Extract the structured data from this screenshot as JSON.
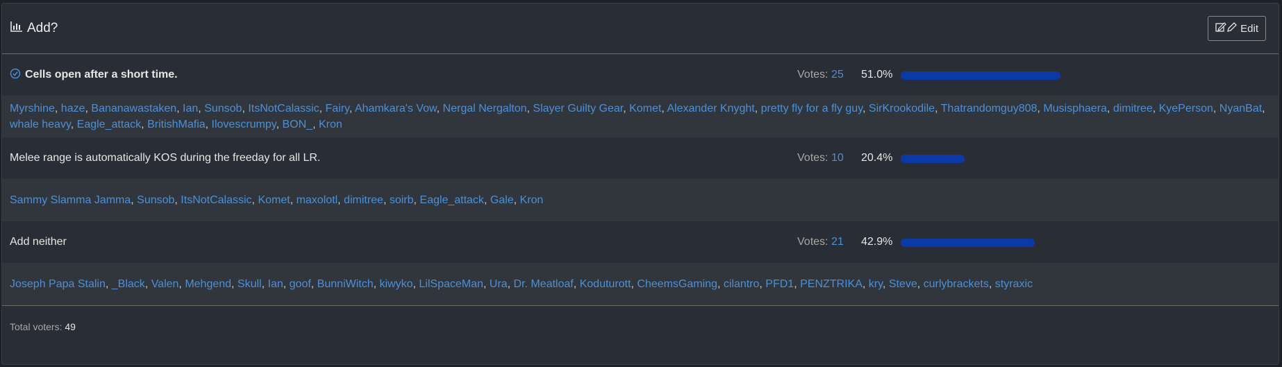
{
  "poll": {
    "title": "Add?",
    "edit_label": "Edit",
    "votes_prefix": "Votes:",
    "options": [
      {
        "label": "Cells open after a short time.",
        "votes": "25",
        "percent": "51.0%",
        "fraction": 0.51,
        "voters": [
          "Myrshine",
          "haze",
          "Bananawastaken",
          "Ian",
          "Sunsob",
          "ItsNotCalassic",
          "Fairy",
          "Ahamkara's Vow",
          "Nergal Nergalton",
          "Slayer Guilty Gear",
          "Komet",
          "Alexander Knyght",
          "pretty fly for a fly guy",
          "SirKrookodile",
          "Thatrandomguy808",
          "Musisphaera",
          "dimitree",
          "KyePerson",
          "NyanBat",
          "whale heavy",
          "Eagle_attack",
          "BritishMafia",
          "Ilovescrumpy",
          "BON_",
          "Kron"
        ]
      },
      {
        "label": "Melee range is automatically KOS during the freeday for all LR.",
        "votes": "10",
        "percent": "20.4%",
        "fraction": 0.204,
        "voters": [
          "Sammy Slamma Jamma",
          "Sunsob",
          "ItsNotCalassic",
          "Komet",
          "maxolotl",
          "dimitree",
          "soirb",
          "Eagle_attack",
          "Gale",
          "Kron"
        ]
      },
      {
        "label": "Add neither",
        "votes": "21",
        "percent": "42.9%",
        "fraction": 0.429,
        "voters": [
          "Joseph Papa Stalin",
          "_Black",
          "Valen",
          "Mehgend",
          "Skull",
          "Ian",
          "goof",
          "BunniWitch",
          "kiwyko",
          "LilSpaceMan",
          "Ura",
          "Dr. Meatloaf",
          "Koduturott",
          "CheemsGaming",
          "cilantro",
          "PFD1",
          "PENZTRIKA",
          "kry",
          "Steve",
          "curlybrackets",
          "styraxic"
        ]
      }
    ],
    "total_label": "Total voters:",
    "total_value": "49"
  }
}
